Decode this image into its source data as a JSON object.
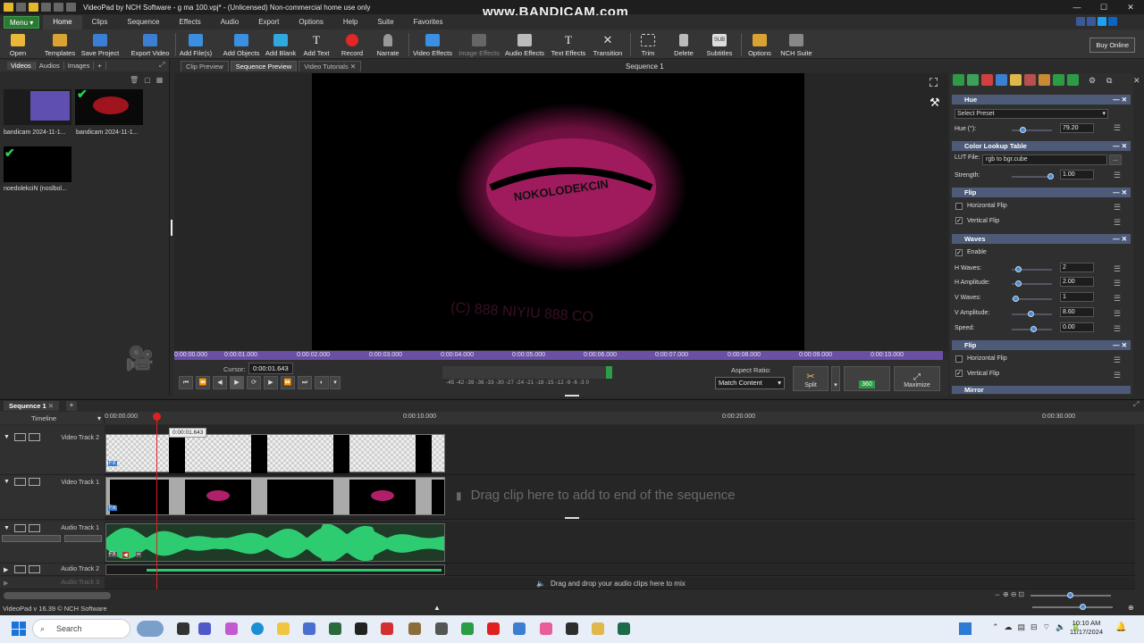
{
  "window": {
    "title": "VideoPad by NCH Software - g ma 100.vpj* - (Unlicensed) Non-commercial home use only",
    "watermark": "www.BANDICAM.com"
  },
  "menu": {
    "button": "Menu ▾",
    "tabs": [
      "Home",
      "Clips",
      "Sequence",
      "Effects",
      "Audio",
      "Export",
      "Options",
      "Help",
      "Suite",
      "Favorites"
    ]
  },
  "toolbar": {
    "items": [
      "Open",
      "Templates",
      "Save Project",
      "Export Video",
      "Add File(s)",
      "Add Objects",
      "Add Blank",
      "Add Text",
      "Record",
      "Narrate",
      "Video Effects",
      "Image Effects",
      "Audio Effects",
      "Text Effects",
      "Transition",
      "Trim",
      "Delete",
      "Subtitles",
      "Options",
      "NCH Suite"
    ],
    "buy_online": "Buy Online"
  },
  "media_bin": {
    "tabs": [
      "Videos",
      "Audios",
      "Images",
      "+"
    ],
    "clips": [
      "bandicam 2024-11-1...",
      "bandicam 2024-11-1...",
      "noedolekciN (noslbol..."
    ]
  },
  "preview": {
    "tabs": [
      "Clip Preview",
      "Sequence Preview",
      "Video Tutorials"
    ],
    "sequence_title": "Sequence 1",
    "ruler_ticks": [
      "0:00:00.000",
      "0:00:01.000",
      "0:00:02.000",
      "0:00:03.000",
      "0:00:04.000",
      "0:00:05.000",
      "0:00:06.000",
      "0:00:07.000",
      "0:00:08.000",
      "0:00:09.000",
      "0:00:10.000"
    ],
    "cursor_label": "Cursor:",
    "cursor_value": "0:00:01.643",
    "meter_scale": "-45 -42 -39 -36 -33 -30 -27 -24 -21 -18 -15 -12 -9 -6 -3 0",
    "aspect_label": "Aspect Ratio:",
    "aspect_value": "Match Content",
    "split": "Split",
    "btn360": "360",
    "maximize": "Maximize"
  },
  "effects": {
    "hue": {
      "title": "Hue",
      "preset": "Select Preset",
      "label": "Hue (°):",
      "value": "79.20"
    },
    "lut": {
      "title": "Color Lookup Table",
      "file_label": "LUT File:",
      "file": "rgb to bgr.cube",
      "strength_label": "Strength:",
      "strength": "1.00"
    },
    "flip1": {
      "title": "Flip",
      "h": "Horizontal Flip",
      "v": "Vertical Flip"
    },
    "waves": {
      "title": "Waves",
      "enable": "Enable",
      "h_waves_label": "H Waves:",
      "h_waves": "2",
      "h_amp_label": "H Amplitude:",
      "h_amp": "2.00",
      "v_waves_label": "V Waves:",
      "v_waves": "1",
      "v_amp_label": "V Amplitude:",
      "v_amp": "8.60",
      "speed_label": "Speed:",
      "speed": "0.00"
    },
    "flip2": {
      "title": "Flip",
      "h": "Horizontal Flip",
      "v": "Vertical Flip"
    },
    "mirror": {
      "title": "Mirror"
    }
  },
  "timeline": {
    "seq_tab": "Sequence 1",
    "label": "Timeline",
    "ticks": [
      "0:00:00.000",
      "0:00:10.000",
      "0:00:20.000",
      "0:00:30.000"
    ],
    "cursor_tip": "0:00:01.643",
    "tracks": [
      "Video Track 2",
      "Video Track 1",
      "Audio Track 1",
      "Audio Track 2",
      "Audio Track 3"
    ],
    "drag_clip": "Drag clip here to add to end of the sequence",
    "drag_audio": "Drag and drop your audio clips here to mix"
  },
  "status": {
    "text": "VideoPad v 16.39 © NCH Software"
  },
  "taskbar": {
    "search": "Search",
    "time": "10:10 AM",
    "date": "11/17/2024"
  }
}
